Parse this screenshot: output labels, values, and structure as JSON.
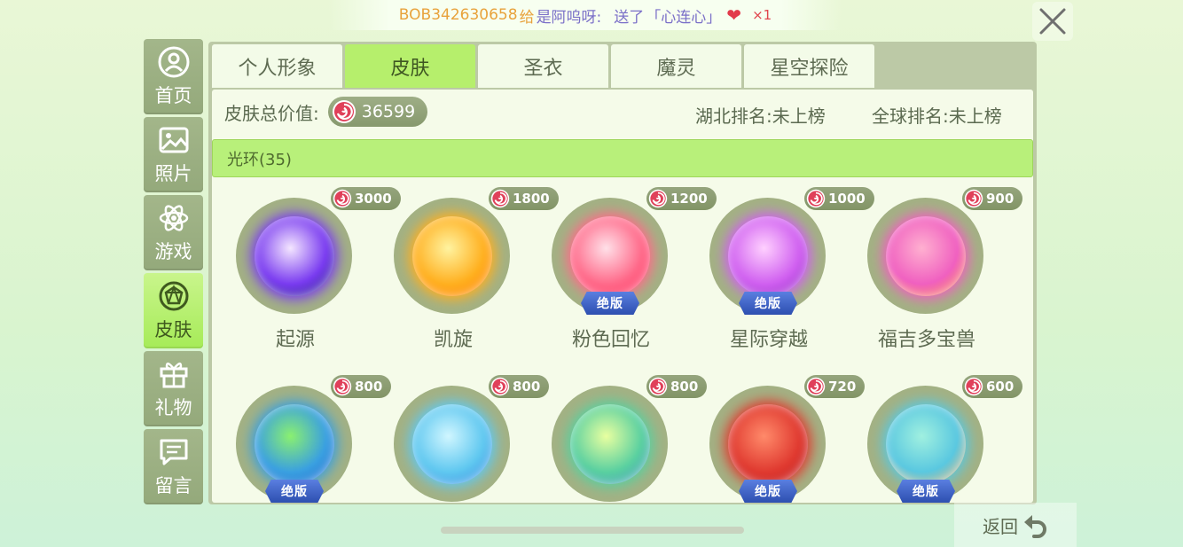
{
  "banner": {
    "user": "BOB342630658",
    "verb": "给",
    "recipient": "是阿呜呀:",
    "action": "送了",
    "gift": "「心连心」",
    "count": "×1",
    "gift_icon": "heart-candy-icon"
  },
  "sidebar": {
    "items": [
      {
        "label": "首页",
        "icon": "user-icon"
      },
      {
        "label": "照片",
        "icon": "photo-icon"
      },
      {
        "label": "游戏",
        "icon": "atom-icon"
      },
      {
        "label": "皮肤",
        "icon": "gem-icon",
        "active": true
      },
      {
        "label": "礼物",
        "icon": "gift-icon"
      },
      {
        "label": "留言",
        "icon": "message-icon"
      }
    ]
  },
  "tabs": [
    {
      "label": "个人形象"
    },
    {
      "label": "皮肤",
      "active": true
    },
    {
      "label": "圣衣"
    },
    {
      "label": "魔灵"
    },
    {
      "label": "星空探险"
    }
  ],
  "summary": {
    "total_label": "皮肤总价值:",
    "total_value": "36599",
    "rank_province": "湖北排名:未上榜",
    "rank_global": "全球排名:未上榜"
  },
  "category": {
    "label": "光环(35)"
  },
  "badge_text": "绝版",
  "items": [
    {
      "name": "起源",
      "price": "3000",
      "limited": false,
      "colors": [
        "#f4e6ff",
        "#7a3cf0",
        "#1a1a7a"
      ]
    },
    {
      "name": "凯旋",
      "price": "1800",
      "limited": false,
      "colors": [
        "#fff3a0",
        "#ffb020",
        "#ff7a00"
      ]
    },
    {
      "name": "粉色回忆",
      "price": "1200",
      "limited": true,
      "colors": [
        "#ffe0e8",
        "#ff6a8a",
        "#ff2a5a"
      ]
    },
    {
      "name": "星际穿越",
      "price": "1000",
      "limited": true,
      "colors": [
        "#ffd0ff",
        "#d060f0",
        "#8a20c0"
      ]
    },
    {
      "name": "福吉多宝兽",
      "price": "900",
      "limited": false,
      "colors": [
        "#ffb0d0",
        "#f060c0",
        "#ff9a40"
      ]
    },
    {
      "name": "",
      "price": "800",
      "limited": true,
      "colors": [
        "#8af070",
        "#3aa0e0",
        "#1a60d0"
      ]
    },
    {
      "name": "",
      "price": "800",
      "limited": false,
      "colors": [
        "#d0f6ff",
        "#60c8f0",
        "#2a80e0"
      ]
    },
    {
      "name": "",
      "price": "800",
      "limited": false,
      "colors": [
        "#e8ffa0",
        "#5ad0a0",
        "#3a90c0"
      ]
    },
    {
      "name": "",
      "price": "720",
      "limited": true,
      "colors": [
        "#ff8a6a",
        "#e03a30",
        "#b81a20"
      ]
    },
    {
      "name": "",
      "price": "600",
      "limited": true,
      "colors": [
        "#a0f0e0",
        "#5ac8e0",
        "#ffb060"
      ]
    }
  ],
  "back": {
    "label": "返回",
    "icon": "back-arrow-icon"
  },
  "colors": {
    "accent": "#b6ef6c",
    "panel": "#bcc9a6",
    "coin": "#e0405a"
  }
}
